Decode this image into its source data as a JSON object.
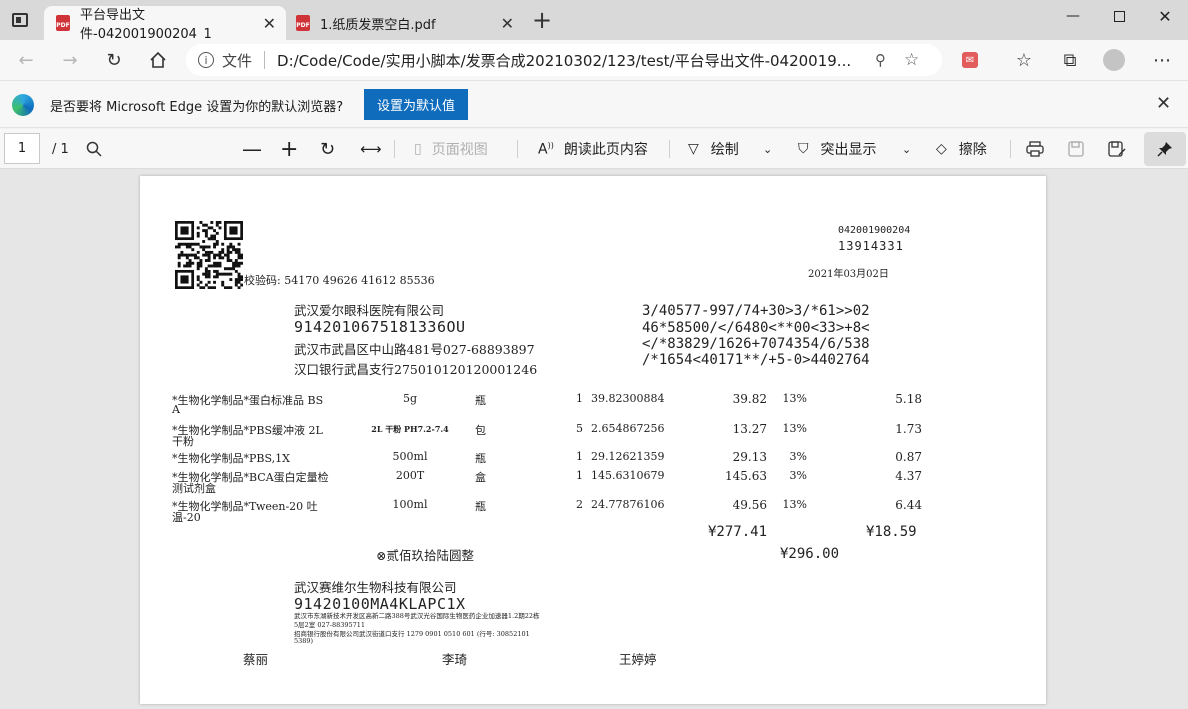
{
  "browser": {
    "tabs": [
      {
        "title": "平台导出文件-042001900204_1",
        "icon": "pdf-icon",
        "active": true
      },
      {
        "title": "1.纸质发票空白.pdf",
        "icon": "pdf-icon",
        "active": false
      }
    ],
    "new_tab": "+",
    "address_prefix": "文件",
    "address": "D:/Code/Code/实用小脚本/发票合成20210302/123/test/平台导出文件-0420019...",
    "infobar": {
      "message": "是否要将 Microsoft Edge 设置为你的默认浏览器?",
      "button": "设置为默认值"
    }
  },
  "pdf_toolbar": {
    "page_current": "1",
    "page_total": "/ 1",
    "page_view": "页面视图",
    "read_aloud": "朗读此页内容",
    "draw": "绘制",
    "highlight": "突出显示",
    "erase": "擦除"
  },
  "invoice": {
    "code": "042001900204",
    "number": "13914331",
    "date": "2021年03月02日",
    "check_code": "校验码: 54170 49626 41612 85536",
    "buyer": {
      "name": "武汉爱尔眼科医院有限公司",
      "tax_id": "9142010675181336OU",
      "address": "武汉市武昌区中山路481号027-68893897",
      "bank": "汉口银行武昌支行275010120120001246"
    },
    "cipher": [
      "3/40577-997/74+30>3/*61>>02",
      "46*58500/</6480<**00<33>+8<",
      "</*83829/1626+7074354/6/538",
      "/*1654<40171**/+5-0>4402764"
    ],
    "items": [
      {
        "name": "*生物化学制品*蛋白标准品 BS",
        "name2": "A",
        "spec": "5g",
        "unit": "瓶",
        "qty": "1",
        "price": "39.82300884",
        "amount": "39.82",
        "rate": "13%",
        "tax": "5.18"
      },
      {
        "name": "*生物化学制品*PBS缓冲液 2L",
        "name2": "干粉",
        "spec": "2L 干粉 PH7.2-7.4",
        "unit": "包",
        "qty": "5",
        "price": "2.654867256",
        "amount": "13.27",
        "rate": "13%",
        "tax": "1.73"
      },
      {
        "name": "*生物化学制品*PBS,1X",
        "name2": "",
        "spec": "500ml",
        "unit": "瓶",
        "qty": "1",
        "price": "29.12621359",
        "amount": "29.13",
        "rate": "3%",
        "tax": "0.87"
      },
      {
        "name": "*生物化学制品*BCA蛋白定量检",
        "name2": "测试剂盒",
        "spec": "200T",
        "unit": "盒",
        "qty": "1",
        "price": "145.6310679",
        "amount": "145.63",
        "rate": "3%",
        "tax": "4.37"
      },
      {
        "name": "*生物化学制品*Tween-20  吐",
        "name2": "温-20",
        "spec": "100ml",
        "unit": "瓶",
        "qty": "2",
        "price": "24.77876106",
        "amount": "49.56",
        "rate": "13%",
        "tax": "6.44"
      }
    ],
    "total_amount": "¥277.41",
    "total_tax": "¥18.59",
    "total_words": "⊗贰佰玖拾陆圆整",
    "total_figure": "¥296.00",
    "seller": {
      "name": "武汉赛维尔生物科技有限公司",
      "tax_id": "91420100MA4KLAPC1X",
      "address_line1": "武汉市东湖新技术开发区高新二路388号武汉光谷国际生物医药企业加速器1.2期22栋",
      "address_line2": "5层2室  027-88395711",
      "bank_line1": "招商银行股份有限公司武汉街道口支行 1279 0901 0510 601  (行号: 30852101",
      "bank_line2": "5389)"
    },
    "payee": "蔡丽",
    "reviewer": "李琦",
    "drawer": "王婷婷"
  }
}
